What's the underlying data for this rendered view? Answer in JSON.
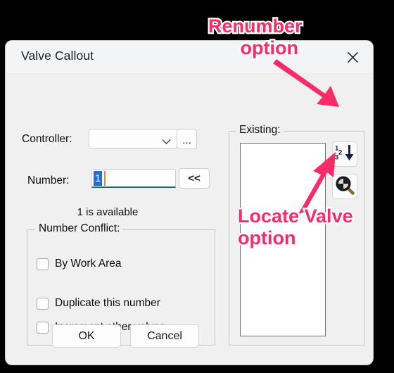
{
  "window": {
    "title": "Valve Callout",
    "close_icon": "close-icon"
  },
  "form": {
    "controller_label": "Controller:",
    "controller_value": "",
    "controller_dropdown_icon": "chevron-down-icon",
    "controller_browse_label": "...",
    "number_label": "Number:",
    "number_value": "1",
    "number_back_label": "<<",
    "availability_text": "1 is available"
  },
  "conflict": {
    "legend": "Number Conflict:",
    "checkboxes": [
      {
        "label": "By Work Area",
        "checked": false
      },
      {
        "label": "Duplicate this number",
        "checked": false
      },
      {
        "label": "Increment other valves",
        "checked": false
      }
    ]
  },
  "existing": {
    "legend": "Existing:",
    "items": [],
    "renumber_icon": "renumber-123-down-arrow-icon",
    "locate_icon": "magnifier-locate-valve-icon"
  },
  "footer": {
    "ok_label": "OK",
    "cancel_label": "Cancel"
  },
  "annotations": {
    "renumber_line1": "Renumber",
    "renumber_line2": "option",
    "locate_line1": "Locate Valve",
    "locate_line2": "option",
    "color": "#fb2a68",
    "outline_color": "#ffffff"
  },
  "colors": {
    "accent_pink": "#fb2a68",
    "dialog_bg": "#f0f0f0",
    "titlebar_bg": "#f3f4f6",
    "focus_blue": "#1a5fb4",
    "selection_blue": "#1f6fd0",
    "page_bg": "#000000"
  }
}
